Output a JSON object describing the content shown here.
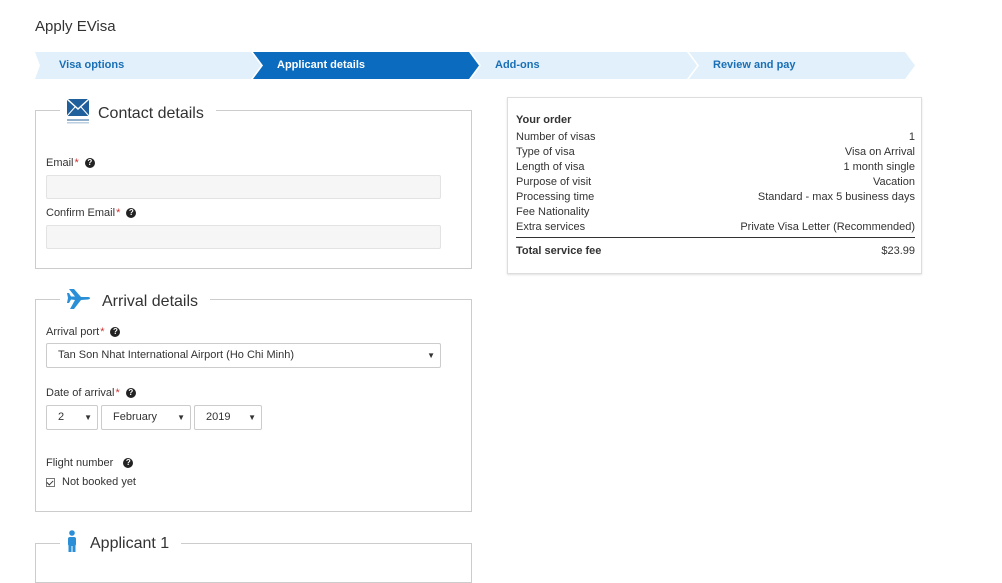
{
  "page": {
    "title": "Apply EVisa"
  },
  "steps": [
    {
      "label": "Visa options",
      "active": false
    },
    {
      "label": "Applicant details",
      "active": true
    },
    {
      "label": "Add-ons",
      "active": false
    },
    {
      "label": "Review and pay",
      "active": false
    }
  ],
  "contact": {
    "title": "Contact details",
    "email_label": "Email",
    "confirm_email_label": "Confirm Email",
    "required_mark": "*",
    "help_glyph": "?",
    "email_value": "",
    "confirm_email_value": ""
  },
  "arrival": {
    "title": "Arrival details",
    "port_label": "Arrival port ",
    "port_value": "Tan Son Nhat International Airport (Ho Chi Minh)",
    "date_label": "Date of arrival",
    "day": "2",
    "month": "February",
    "year": "2019",
    "flight_label": "Flight number",
    "not_booked_label": "Not booked yet",
    "not_booked_checked": true
  },
  "applicant": {
    "title": "Applicant 1"
  },
  "order": {
    "title": "Your order",
    "rows": [
      {
        "label": "Number of visas",
        "value": "1"
      },
      {
        "label": "Type of visa",
        "value": "Visa on Arrival"
      },
      {
        "label": "Length of visa",
        "value": "1 month single"
      },
      {
        "label": "Purpose of visit",
        "value": "Vacation"
      },
      {
        "label": "Processing time",
        "value": "Standard - max 5 business days"
      },
      {
        "label": "Fee Nationality",
        "value": ""
      },
      {
        "label": "Extra services",
        "value": "Private Visa Letter (Recommended)"
      }
    ],
    "total_label": "Total service fee",
    "total_value": "$23.99"
  },
  "colors": {
    "accent": "#0a6bbf",
    "step_bg": "#e1f0fb",
    "icon_blue": "#2a8fd6"
  },
  "icons": {
    "contact": "envelope-icon",
    "arrival": "airplane-icon",
    "applicant": "person-icon",
    "help": "question-circle-icon"
  }
}
